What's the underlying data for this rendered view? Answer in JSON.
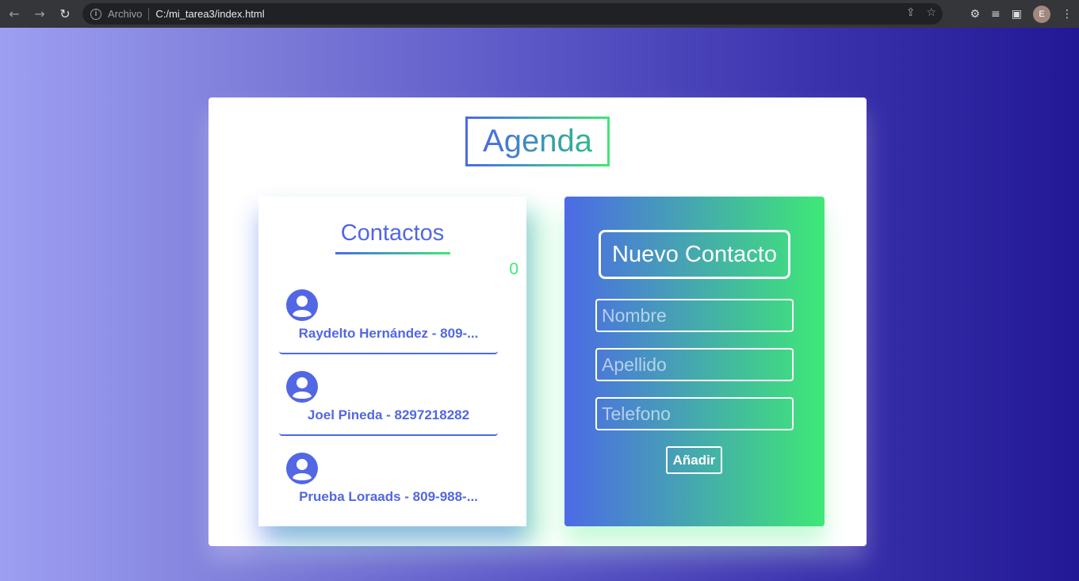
{
  "browser": {
    "back_icon": "arrow-left-icon",
    "forward_icon": "arrow-right-icon",
    "reload_icon": "reload-icon",
    "scheme": "Archivo",
    "url": "C:/mi_tarea3/index.html",
    "avatar_initial": "E"
  },
  "app": {
    "title": "Agenda",
    "contacts_title": "Contactos",
    "counter": "0",
    "contacts": [
      {
        "label": "Raydelto Hernández - 809-..."
      },
      {
        "label": "Joel Pineda - 8297218282"
      },
      {
        "label": "Prueba Loraads - 809-988-..."
      }
    ],
    "form": {
      "title": "Nuevo Contacto",
      "name_placeholder": "Nombre",
      "lastname_placeholder": "Apellido",
      "phone_placeholder": "Telefono",
      "add_label": "Añadir"
    }
  },
  "colors": {
    "accent_blue": "#4c6ae6",
    "accent_green": "#3ee876"
  }
}
